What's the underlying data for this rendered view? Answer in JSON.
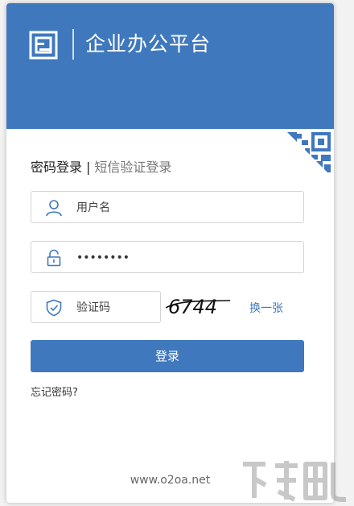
{
  "header": {
    "title": "企业办公平台",
    "logo_icon": "o2oa-logo-icon"
  },
  "tabs": {
    "active": "密码登录",
    "separator": "|",
    "inactive": "短信验证登录"
  },
  "form": {
    "username": {
      "placeholder": "用户名",
      "icon": "user-icon"
    },
    "password": {
      "value": "••••••••",
      "icon": "lock-icon"
    },
    "captcha": {
      "placeholder": "验证码",
      "icon": "shield-icon",
      "image_text": "6744",
      "refresh_label": "换一张"
    },
    "login_label": "登录",
    "forgot_label": "忘记密码?"
  },
  "footer": {
    "url": "www.o2oa.net"
  },
  "colors": {
    "brand": "#3f78bd",
    "background": "#ffffff",
    "border": "#d4d4d4"
  }
}
